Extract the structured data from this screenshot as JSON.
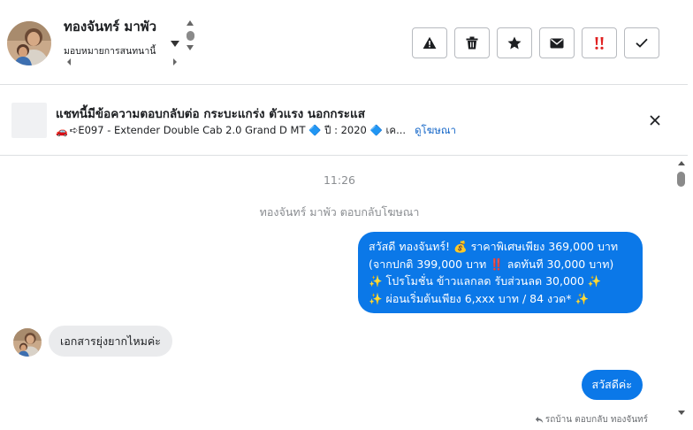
{
  "header": {
    "contact_name": "ทองจันทร์ มาพัว",
    "assign_label": "มอบหมายการสนทนานี้"
  },
  "toolbar": {
    "buttons": [
      {
        "name": "spam-button",
        "icon": "warning-triangle-icon"
      },
      {
        "name": "delete-button",
        "icon": "trash-icon"
      },
      {
        "name": "star-button",
        "icon": "star-icon"
      },
      {
        "name": "mark-unread-button",
        "icon": "envelope-icon"
      },
      {
        "name": "follow-up-button",
        "icon": "double-exclamation-icon"
      },
      {
        "name": "done-button",
        "icon": "checkmark-icon"
      }
    ]
  },
  "ad_banner": {
    "title": "แชทนี้มีข้อความตอบกลับต่อ กระบะแกร่ง ตัวแรง นอกกระแส",
    "car_emoji": "🚗",
    "subtitle": "➪E097 - Extender Double Cab 2.0 Grand D MT 🔷 ปี : 2020 🔷 เค...",
    "view_ad_link": "ดูโฆษณา"
  },
  "chat": {
    "timestamp": "11:26",
    "system_note": "ทองจันทร์ มาพัว ตอบกลับโฆษณา",
    "promo_message_lines": [
      "สวัสดี ทองจันทร์! 💰 ราคาพิเศษเพียง 369,000 บาท",
      "(จากปกติ 399,000 บาท ‼️ ลดทันที 30,000 บาท)",
      "✨ โปรโมชั่น ข้าวแลกลด รับส่วนลด 30,000 ✨",
      "✨ ผ่อนเริ่มต้นเพียง 6,xxx บาท / 84 งวด* ✨"
    ],
    "incoming_message": "เอกสารยุ่งยากไหมค่ะ",
    "outgoing_message": "สวัสดีค่ะ",
    "reply_note": "รถบ้าน ตอบกลับ ทองจันทร์"
  },
  "colors": {
    "outgoing_bubble": "#0b78e8",
    "incoming_bubble": "#eaebed",
    "link": "#1466c8",
    "follow_up_icon": "#e02020"
  }
}
